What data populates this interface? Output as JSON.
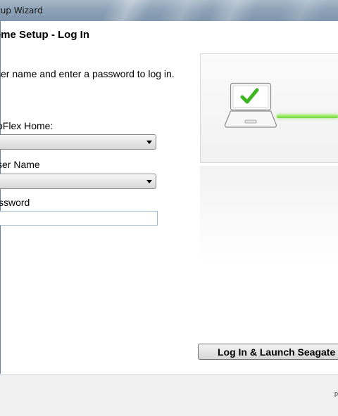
{
  "window": {
    "title": "tup Wizard"
  },
  "header": {
    "title": "ome Setup - Log In"
  },
  "instruction": "ser name and enter a password to log in.",
  "form": {
    "home_label": "oFlex Home:",
    "home_value": "",
    "username_label": "ser Name",
    "username_value": "",
    "password_label": "ssword",
    "password_value": ""
  },
  "actions": {
    "launch_label": "Log In & Launch Seagate D"
  },
  "footer": {
    "fragment": "p"
  },
  "colors": {
    "progress_green": "#73d63a",
    "check_green": "#3cb521"
  },
  "icons": [
    "laptop-icon",
    "checkmark-icon",
    "dropdown-arrow-icon"
  ]
}
